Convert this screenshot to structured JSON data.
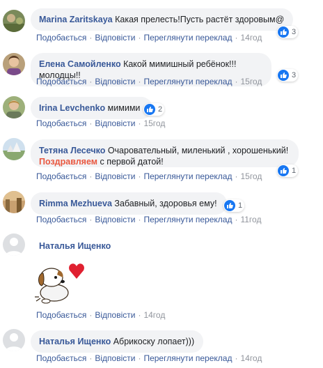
{
  "actions": {
    "like": "Подобається",
    "reply": "Відповісти",
    "translate": "Переглянути переклад"
  },
  "comments": [
    {
      "author": "Marina Zaritskaya",
      "text": "Какая прелесть!Пусть растёт здоровым@",
      "reactions": "3",
      "time": "14год",
      "translate": true
    },
    {
      "author": "Елена Самойленко",
      "text": "Какой мимишный ребёнок!!!молодцы!!",
      "reactions": "3",
      "time": "15год",
      "translate": true
    },
    {
      "author": "Irina Levchenko",
      "text": "мимими",
      "reactions": "2",
      "time": "15год",
      "translate": false
    },
    {
      "author": "Тетяна Лесечко",
      "text_part1": "Очаровательный, миленький , хорошенький!",
      "mention": "Поздравляем",
      "text_part2": "с первой датой!",
      "reactions": "1",
      "time": "15год",
      "translate": true
    },
    {
      "author": "Rimma Mezhueva",
      "text": "Забавный, здоровья ему!",
      "reactions": "1",
      "time": "11год",
      "translate": true
    },
    {
      "author": "Наталья Ищенко",
      "sticker": "puppy-heart-sticker",
      "time": "14год",
      "translate": false
    },
    {
      "author": "Наталья Ищенко",
      "text": "Абрикоску лопает)))",
      "time": "14год",
      "translate": true
    }
  ],
  "colors": {
    "author": "#385898",
    "bubble": "#f2f3f5",
    "like": "#1877f2",
    "mention": "#e9573f",
    "meta": "#90949c"
  }
}
